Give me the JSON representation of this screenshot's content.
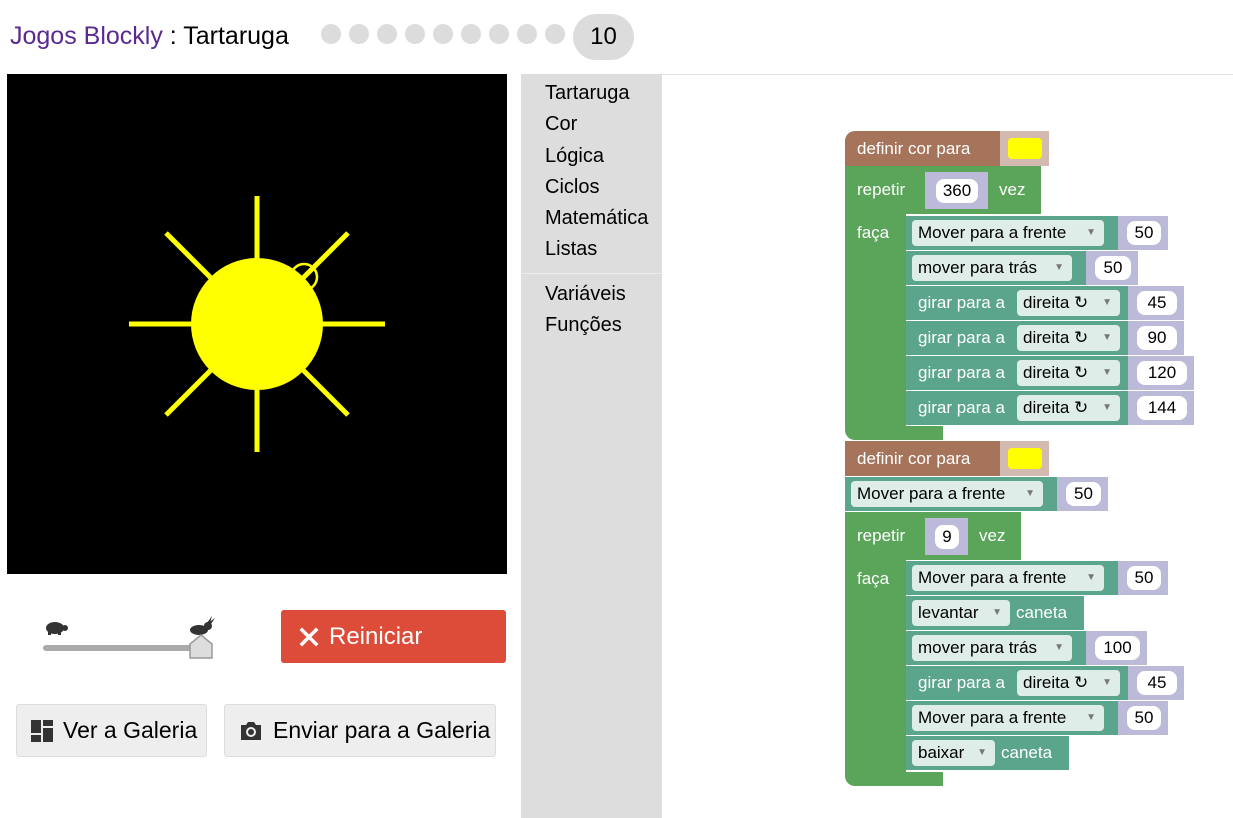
{
  "header": {
    "app_title": "Jogos Blockly",
    "separator": " : ",
    "game_name": "Tartaruga",
    "level": "10"
  },
  "controls": {
    "reset_label": "Reiniciar",
    "gallery_label": "Ver a Galeria",
    "submit_label": "Enviar para a Galeria",
    "speed_level": 1.0
  },
  "toolbox": {
    "categories": [
      "Tartaruga",
      "Cor",
      "Lógica",
      "Ciclos",
      "Matemática",
      "Listas",
      "Variáveis",
      "Funções"
    ]
  },
  "colors": {
    "title_link": "#5a2a91",
    "reset": "#dd4b39",
    "sun": "#ffff00",
    "loop_block": "#5ba55b",
    "turtle_block": "#5ba58c",
    "color_block": "#a5745b",
    "value_socket": "#bbbbd9"
  },
  "program": {
    "stack1": {
      "set_color": "definir cor para",
      "repeat_label": "repetir",
      "repeat_times": "360",
      "times_label": "vez",
      "do_label": "faça",
      "move_forward": "Mover para a frente",
      "move_forward_value": "50",
      "move_back": "mover para trás",
      "move_back_value": "50",
      "turn_label": "girar para a",
      "turn_dir": "direita ↻",
      "turn_values": [
        "45",
        "90",
        "120",
        "144"
      ]
    },
    "stack2": {
      "set_color": "definir cor para",
      "move_forward": "Mover para a frente",
      "move_forward_value": "50",
      "repeat_label": "repetir",
      "repeat_times": "9",
      "times_label": "vez",
      "do_label": "faça",
      "inner_move_forward": "Mover para a frente",
      "inner_move_forward_value": "50",
      "pen_up_dd": "levantar",
      "pen_label": "caneta",
      "move_back": "mover para trás",
      "move_back_value": "100",
      "turn_label": "girar para a",
      "turn_dir": "direita ↻",
      "turn_value": "45",
      "last_move_forward": "Mover para a frente",
      "last_move_forward_value": "50",
      "pen_down_dd": "baixar",
      "pen_label_2": "caneta"
    }
  }
}
